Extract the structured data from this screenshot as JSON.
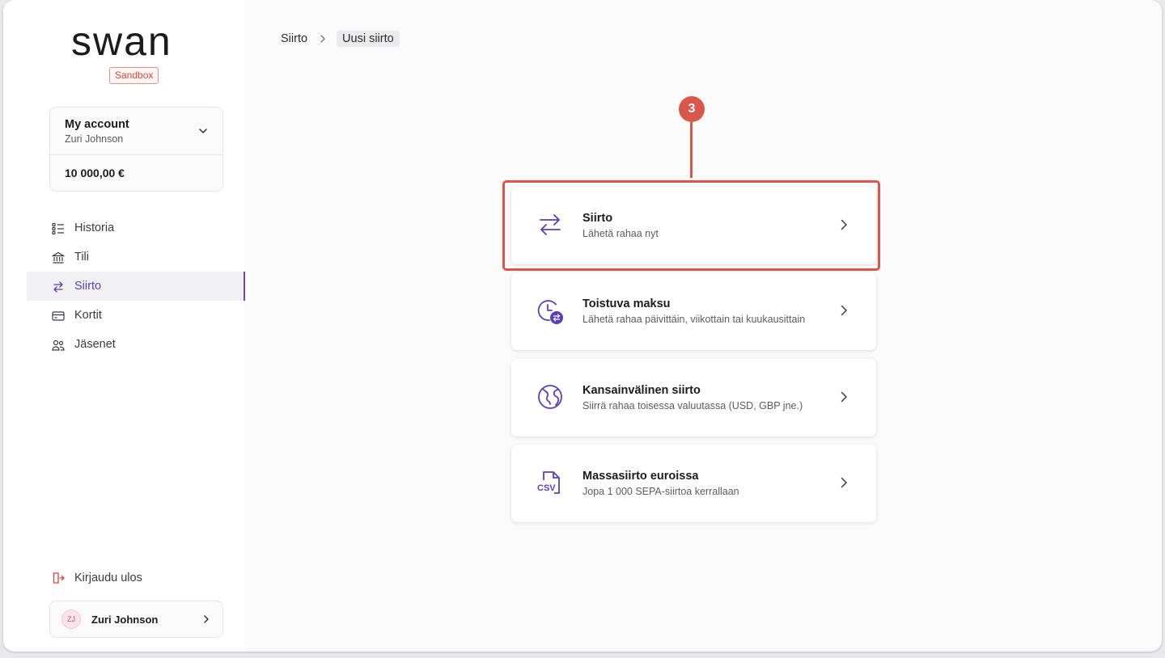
{
  "brand": {
    "logo_text": "swan",
    "environment_badge": "Sandbox",
    "accent": "#6a45c9",
    "highlight": "#d9574a"
  },
  "account": {
    "name": "My account",
    "holder": "Zuri Johnson",
    "balance": "10 000,00 €"
  },
  "nav": [
    {
      "label": "Historia",
      "icon": "list-icon",
      "active": false
    },
    {
      "label": "Tili",
      "icon": "bank-icon",
      "active": false
    },
    {
      "label": "Siirto",
      "icon": "transfer-icon",
      "active": true
    },
    {
      "label": "Kortit",
      "icon": "card-icon",
      "active": false
    },
    {
      "label": "Jäsenet",
      "icon": "members-icon",
      "active": false
    }
  ],
  "logout_label": "Kirjaudu ulos",
  "user": {
    "initials": "ZJ",
    "name": "Zuri Johnson"
  },
  "breadcrumb": {
    "parent": "Siirto",
    "current": "Uusi siirto"
  },
  "step_number": "3",
  "options": [
    {
      "title": "Siirto",
      "subtitle": "Lähetä rahaa nyt",
      "icon": "transfer-icon"
    },
    {
      "title": "Toistuva maksu",
      "subtitle": "Lähetä rahaa päivittäin, viikottain tai kuukausittain",
      "icon": "recurring-clock-icon"
    },
    {
      "title": "Kansainvälinen siirto",
      "subtitle": "Siirrä rahaa toisessa valuutassa (USD, GBP jne.)",
      "icon": "globe-icon"
    },
    {
      "title": "Massasiirto euroissa",
      "subtitle": "Jopa 1 000 SEPA-siirtoa kerrallaan",
      "icon": "csv-file-icon",
      "icon_text": "CSV"
    }
  ]
}
